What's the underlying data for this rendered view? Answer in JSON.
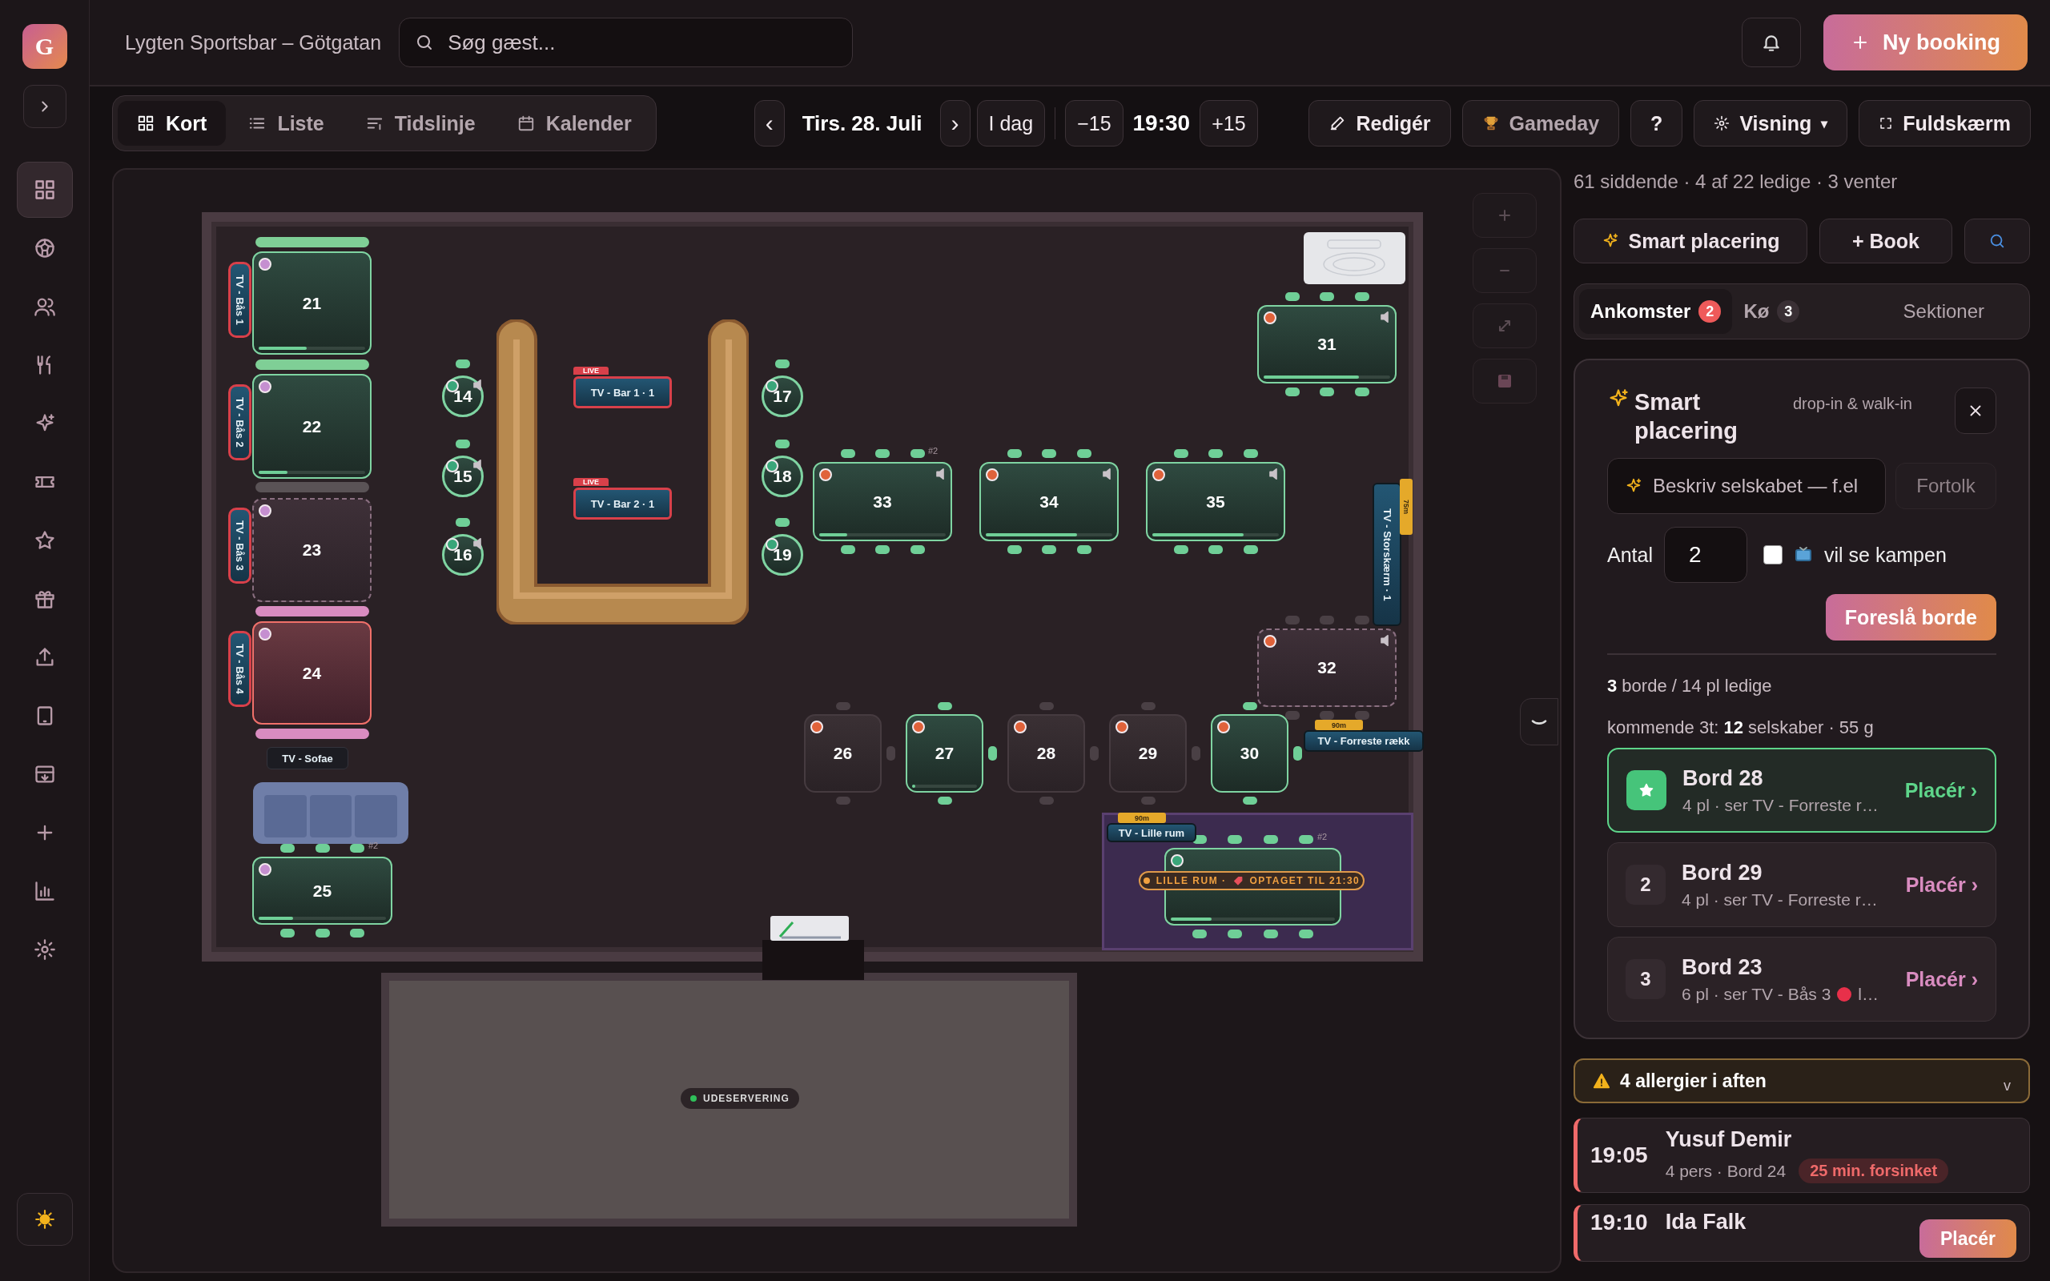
{
  "app": {
    "logo": "G"
  },
  "sidebar": {
    "items": [
      {
        "selected": true
      },
      {
        "selected": false
      },
      {
        "selected": false
      },
      {
        "selected": false
      },
      {
        "selected": false
      },
      {
        "selected": false
      },
      {
        "selected": false
      },
      {
        "selected": false
      },
      {
        "selected": false
      },
      {
        "selected": false
      },
      {
        "selected": false
      },
      {
        "selected": false
      },
      {
        "selected": false
      },
      {
        "selected": false
      }
    ]
  },
  "header": {
    "venue": "Lygten Sportsbar – Götgatan",
    "search": {
      "placeholder": "Søg gæst..."
    },
    "new_booking": "Ny booking"
  },
  "toolbar": {
    "views": [
      {
        "label": "Kort",
        "selected": true
      },
      {
        "label": "Liste",
        "selected": false
      },
      {
        "label": "Tidslinje",
        "selected": false
      },
      {
        "label": "Kalender",
        "selected": false
      }
    ],
    "prev": "‹",
    "date": "Tirs. 28. Juli",
    "next": "›",
    "today": "I dag",
    "minus": "−15",
    "time": "19:30",
    "plus": "+15",
    "actions": [
      {
        "kind": "edit",
        "label": "Redigér"
      },
      {
        "kind": "gameday",
        "label": "Gameday"
      },
      {
        "kind": "help",
        "label": "?"
      },
      {
        "kind": "view",
        "label": "Visning",
        "caret": "▾"
      },
      {
        "kind": "fullscreen",
        "label": "Fuldskærm"
      }
    ]
  },
  "floor": {
    "benches": [
      {
        "color": "#7fcf96"
      },
      {
        "color": "#7fcf96"
      },
      {
        "color": "#5a5356"
      },
      {
        "color": "#d98cc0"
      },
      {
        "color": "#d98cc0"
      }
    ],
    "tables": [
      {
        "number": "21",
        "kind": "booth",
        "free": true,
        "reserved": false,
        "late": false,
        "color": "#c58fd0",
        "level": 0.45,
        "audio": false
      },
      {
        "number": "22",
        "kind": "booth",
        "free": true,
        "reserved": false,
        "late": false,
        "color": "#c58fd0",
        "level": 0.27,
        "audio": false
      },
      {
        "number": "23",
        "kind": "booth",
        "free": false,
        "reserved": true,
        "late": false,
        "color": "#c58fd0",
        "audio": false
      },
      {
        "number": "24",
        "kind": "booth",
        "free": false,
        "reserved": false,
        "late": true,
        "color": "#c58fd0",
        "audio": false
      },
      {
        "number": "25",
        "kind": "long",
        "free": true,
        "reserved": false,
        "late": false,
        "color": "#c58fd0",
        "level": 0.27,
        "audio": false,
        "mark": "#2"
      },
      {
        "number": "14",
        "kind": "round",
        "free": true,
        "reserved": false,
        "late": false,
        "color": "#3aa67a",
        "audio": true
      },
      {
        "number": "15",
        "kind": "round",
        "free": true,
        "reserved": false,
        "late": false,
        "color": "#3aa67a",
        "audio": true
      },
      {
        "number": "16",
        "kind": "round",
        "free": true,
        "reserved": false,
        "late": false,
        "color": "#3aa67a",
        "audio": true
      },
      {
        "number": "17",
        "kind": "round",
        "free": true,
        "reserved": false,
        "late": false,
        "color": "#3aa67a",
        "audio": false
      },
      {
        "number": "18",
        "kind": "round",
        "free": true,
        "reserved": false,
        "late": false,
        "color": "#3aa67a",
        "audio": false
      },
      {
        "number": "19",
        "kind": "round",
        "free": true,
        "reserved": false,
        "late": false,
        "color": "#3aa67a",
        "audio": false
      },
      {
        "number": "31",
        "kind": "long",
        "free": true,
        "reserved": false,
        "late": false,
        "color": "#e0623a",
        "level": 0.75,
        "audio": true
      },
      {
        "number": "33",
        "kind": "long",
        "free": true,
        "reserved": false,
        "late": false,
        "color": "#e0623a",
        "level": 0.22,
        "audio": true,
        "mark": "#2"
      },
      {
        "number": "34",
        "kind": "long",
        "free": true,
        "reserved": false,
        "late": false,
        "color": "#e0623a",
        "level": 0.72,
        "audio": true
      },
      {
        "number": "35",
        "kind": "long",
        "free": true,
        "reserved": false,
        "late": false,
        "color": "#e0623a",
        "level": 0.72,
        "audio": true
      },
      {
        "number": "32",
        "kind": "long",
        "free": false,
        "reserved": true,
        "late": false,
        "color": "#e0623a",
        "audio": true
      },
      {
        "number": "26",
        "kind": "square",
        "free": false,
        "reserved": false,
        "late": false,
        "color": "#e0623a",
        "audio": false
      },
      {
        "number": "27",
        "kind": "square",
        "free": true,
        "reserved": false,
        "late": false,
        "color": "#e0623a",
        "level": 0.05,
        "audio": false
      },
      {
        "number": "28",
        "kind": "square",
        "free": false,
        "reserved": false,
        "late": false,
        "color": "#e0623a",
        "audio": false
      },
      {
        "number": "29",
        "kind": "square",
        "free": false,
        "reserved": false,
        "late": false,
        "color": "#e0623a",
        "audio": false
      },
      {
        "number": "30",
        "kind": "square",
        "free": true,
        "reserved": false,
        "late": false,
        "color": "#e0623a",
        "audio": false
      },
      {
        "kind": "wide",
        "free": true,
        "reserved": false,
        "late": false,
        "color": "#3aa67a",
        "level": 0.25,
        "audio": false,
        "mark": "#2"
      }
    ],
    "tvs": [
      {
        "kind": "vertical",
        "label": "TV - Bås 1"
      },
      {
        "kind": "vertical",
        "label": "TV - Bås 2"
      },
      {
        "kind": "vertical",
        "label": "TV - Bås 3"
      },
      {
        "kind": "vertical",
        "label": "TV - Bås 4"
      },
      {
        "kind": "horizontal",
        "label": "TV - Sofae"
      },
      {
        "kind": "horizontal",
        "label": "TV - Bar 1 · 1",
        "live": "LIVE"
      },
      {
        "kind": "horizontal",
        "label": "TV - Bar 2 · 1",
        "live": "LIVE"
      },
      {
        "kind": "vertical",
        "label": "TV - Storskærm · 1",
        "tag": "75m"
      },
      {
        "kind": "horizontal",
        "label": "TV - Forreste rækk",
        "tag": "90m"
      },
      {
        "kind": "horizontal",
        "label": "TV - Lille rum",
        "tag": "90m"
      }
    ],
    "room_badge": {
      "room": "LILLE RUM ·",
      "text": "OPTAGET TIL 21:30"
    },
    "outdoor": {
      "label": "UDESERVERING"
    }
  },
  "panel": {
    "stats": "61 siddende · 4 af 22 ledige · 3 venter",
    "actions": [
      {
        "kind": "smart",
        "label": "Smart placering"
      },
      {
        "kind": "book",
        "label": "+ Book"
      },
      {
        "kind": "search"
      }
    ],
    "tabs": [
      {
        "label": "Ankomster",
        "badge": "2",
        "selected": true
      },
      {
        "label": "Kø",
        "badge": "3",
        "selected": false
      },
      {
        "label": "Sektioner",
        "selected": false
      }
    ],
    "smart": {
      "title": "Smart placering",
      "subtitle": "drop-in & walk-in",
      "query": {
        "placeholder": "Beskriv selskabet — f.el"
      },
      "interpret": "Fortolk",
      "count_label": "Antal",
      "count": "2",
      "watch": {
        "label": "vil se kampen",
        "checked": false
      },
      "suggest": "Foreslå borde",
      "summary": "**3** borde / 14 pl ledige",
      "upcoming": "kommende 3t: **12** selskaber · 55 g",
      "suggestions": [
        {
          "kind": "best",
          "title": "Bord 28",
          "detail": "4 pl · ser TV - Forreste r…",
          "action": "Placér ›",
          "selected": true
        },
        {
          "kind": "rank",
          "rank": "2",
          "title": "Bord 29",
          "detail": "4 pl · ser TV - Forreste r…",
          "action": "Placér ›",
          "selected": false
        },
        {
          "kind": "rank",
          "rank": "3",
          "title": "Bord 23",
          "detail": "6 pl · ser TV - Bås 3",
          "detail_end": "l…",
          "action": "Placér ›",
          "selected": false
        }
      ]
    },
    "allergy": {
      "label": "4 allergier i aften",
      "toggle": "v"
    },
    "arrivals": [
      {
        "time": "19:05",
        "name": "Yusuf Demir",
        "detail": "4 pers · Bord 24",
        "status": "25 min. forsinket"
      },
      {
        "time": "19:10",
        "name": "Ida Falk",
        "action": "Placér"
      }
    ]
  }
}
